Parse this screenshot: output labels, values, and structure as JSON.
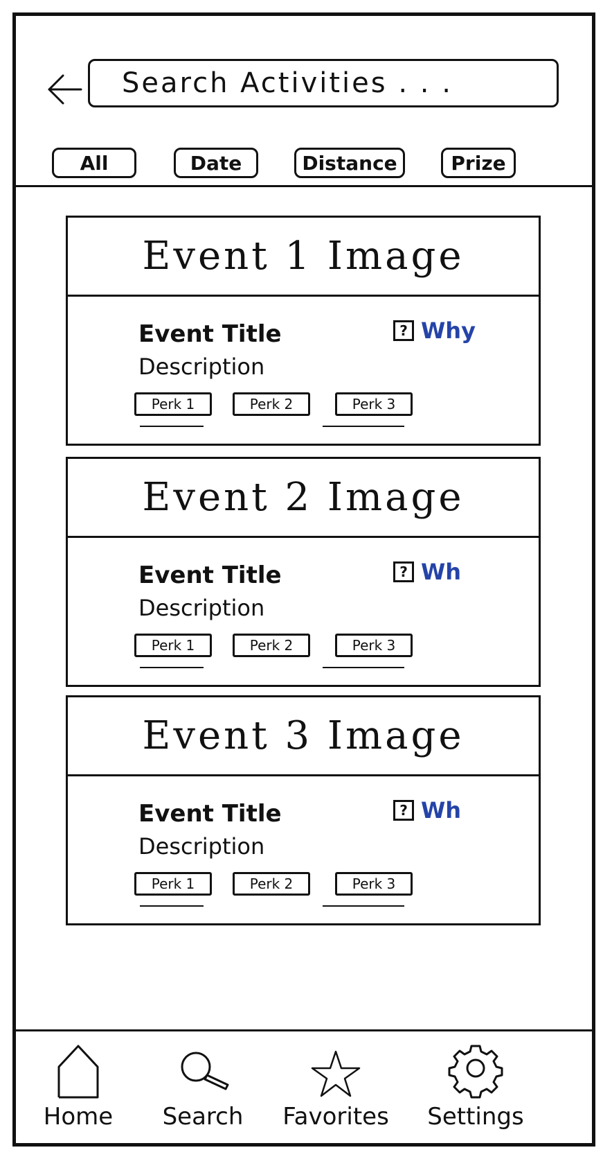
{
  "header": {
    "back_icon": "arrow-left-icon",
    "search_placeholder": "Search    Activities  . . ."
  },
  "filters": [
    "All",
    "Date",
    "Distance",
    "Prize"
  ],
  "events": [
    {
      "image_label": "Event 1 Image",
      "title": "Event Title",
      "description": "Description",
      "why_label": "Why",
      "perks": [
        "Perk 1",
        "Perk 2",
        "Perk 3"
      ]
    },
    {
      "image_label": "Event 2 Image",
      "title": "Event Title",
      "description": "Description",
      "why_label": "Wh",
      "perks": [
        "Perk 1",
        "Perk 2",
        "Perk 3"
      ]
    },
    {
      "image_label": "Event 3 Image",
      "title": "Event Title",
      "description": "Description",
      "why_label": "Wh",
      "perks": [
        "Perk 1",
        "Perk 2",
        "Perk 3"
      ]
    }
  ],
  "nav": [
    {
      "label": "Home",
      "icon": "home-icon"
    },
    {
      "label": "Search",
      "icon": "search-icon"
    },
    {
      "label": "Favorites",
      "icon": "star-icon"
    },
    {
      "label": "Settings",
      "icon": "gear-icon"
    }
  ],
  "colors": {
    "ink": "#111111",
    "why_link": "#2544a8"
  }
}
